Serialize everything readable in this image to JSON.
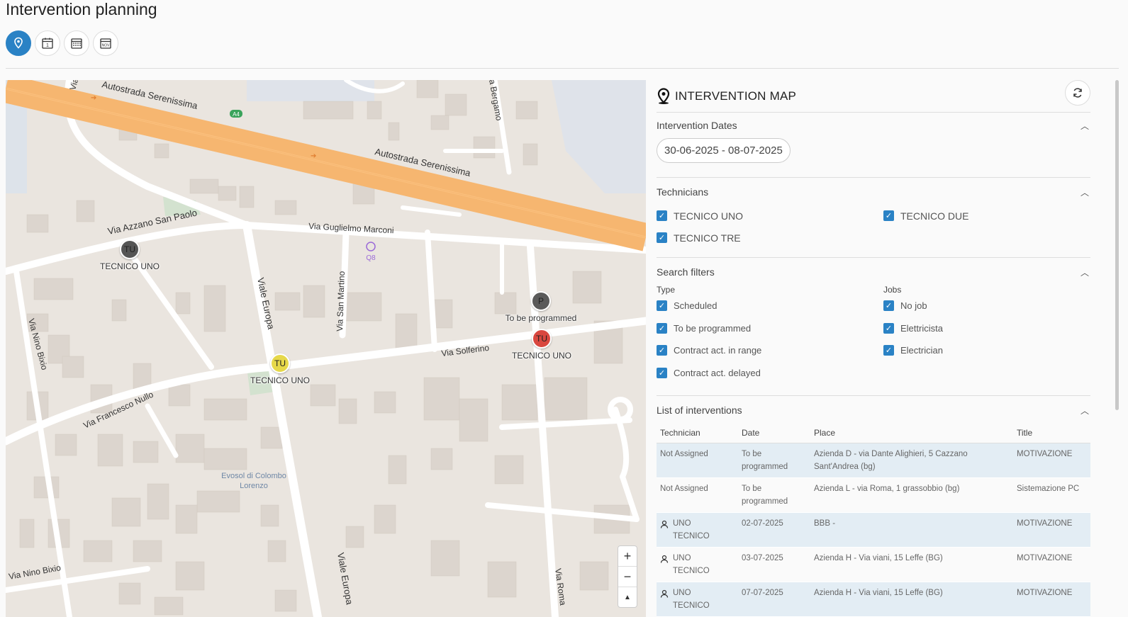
{
  "page_title": "Intervention planning",
  "view_buttons": [
    {
      "icon": "map-pin-icon",
      "active": true
    },
    {
      "icon": "calendar-day-icon",
      "active": false
    },
    {
      "icon": "calendar-month-icon",
      "active": false
    },
    {
      "icon": "calendar-nov-icon",
      "active": false
    }
  ],
  "map": {
    "labels": {
      "autostrada_1": "Autostrada Serenissima",
      "autostrada_2": "Autostrada Serenissima",
      "a4": "A4",
      "via_bergamo": "a Bergamo",
      "via_azzano": "Via Azzano San Paolo",
      "via_marconi": "Via Guglielmo Marconi",
      "q8": "Q8",
      "viale_europa_1": "Viale Europa",
      "via_san_martino": "Via San Martino",
      "via_nino_bixio_1": "Via Nino Bixio",
      "via_solferino": "Via Solferino",
      "via_francesco_nullo": "Via Francesco Nullo",
      "evosol": "Evosol di Colombo Lorenzo",
      "via_nino_bixio_2": "Via Nino Bixio",
      "viale_europa_2": "Viale Europa",
      "via_roma": "Via Roma",
      "via_top": "Via"
    },
    "markers": [
      {
        "initials": "TU",
        "label": "TECNICO UNO",
        "color": "#555555"
      },
      {
        "initials": "P",
        "label": "To be programmed",
        "color": "#5a5a5a"
      },
      {
        "initials": "TU",
        "label": "TECNICO UNO",
        "color": "#d9473f"
      },
      {
        "initials": "TU",
        "label": "TECNICO UNO",
        "color": "#e6d84a"
      }
    ],
    "zoom": {
      "in": "+",
      "out": "−",
      "north": "▲"
    }
  },
  "panel": {
    "title": "INTERVENTION MAP",
    "dates_section": "Intervention Dates",
    "date_range": "30-06-2025 - 08-07-2025",
    "technicians_section": "Technicians",
    "technicians": [
      "TECNICO UNO",
      "TECNICO DUE",
      "TECNICO TRE"
    ],
    "filters_section": "Search filters",
    "type_label": "Type",
    "types": [
      "Scheduled",
      "To be programmed",
      "Contract act. in range",
      "Contract act. delayed"
    ],
    "jobs_label": "Jobs",
    "jobs": [
      "No job",
      "Elettricista",
      "Electrician"
    ],
    "list_section": "List of interventions",
    "columns": [
      "Technician",
      "Date",
      "Place",
      "Title"
    ],
    "rows": [
      {
        "tech": "Not Assigned",
        "date": "To be programmed",
        "place": "Azienda D - via Dante Alighieri, 5 Cazzano Sant'Andrea (bg)",
        "title": "MOTIVAZIONE",
        "user": false
      },
      {
        "tech": "Not Assigned",
        "date": "To be programmed",
        "place": "Azienda L - via Roma, 1 grassobbio (bg)",
        "title": "Sistemazione PC",
        "user": false
      },
      {
        "tech": "UNO TECNICO",
        "date": "02-07-2025",
        "place": "BBB -",
        "title": "MOTIVAZIONE",
        "user": true
      },
      {
        "tech": "UNO TECNICO",
        "date": "03-07-2025",
        "place": "Azienda H - Via viani, 15 Leffe (BG)",
        "title": "MOTIVAZIONE",
        "user": true
      },
      {
        "tech": "UNO TECNICO",
        "date": "07-07-2025",
        "place": "Azienda H - Via viani, 15 Leffe (BG)",
        "title": "MOTIVAZIONE",
        "user": true
      }
    ]
  }
}
